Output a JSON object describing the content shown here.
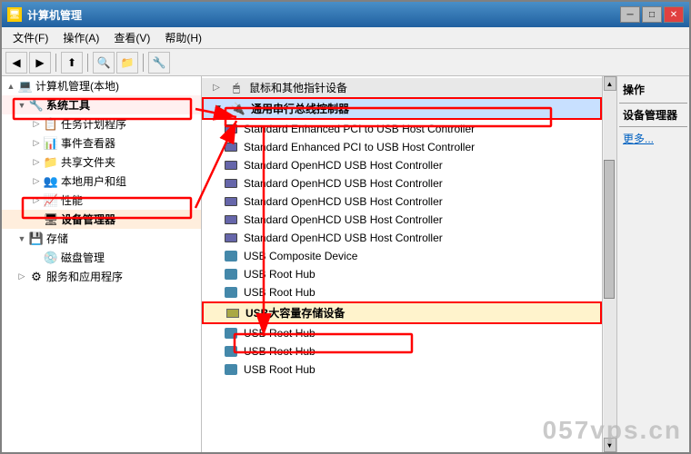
{
  "window": {
    "title": "计算机管理",
    "title_icon": "🖥",
    "btn_min": "─",
    "btn_max": "□",
    "btn_close": "✕"
  },
  "menubar": {
    "items": [
      {
        "label": "文件(F)"
      },
      {
        "label": "操作(A)"
      },
      {
        "label": "查看(V)"
      },
      {
        "label": "帮助(H)"
      }
    ]
  },
  "toolbar": {
    "buttons": [
      "◀",
      "▶",
      "⬆",
      "🔍",
      "📋",
      "🔧",
      "📄"
    ]
  },
  "left_panel": {
    "root": "计算机管理(本地)",
    "items": [
      {
        "label": "系统工具",
        "level": 1,
        "expanded": true,
        "selected": false,
        "highlight": true
      },
      {
        "label": "任务计划程序",
        "level": 2,
        "expanded": false,
        "selected": false
      },
      {
        "label": "事件查看器",
        "level": 2,
        "expanded": false,
        "selected": false
      },
      {
        "label": "共享文件夹",
        "level": 2,
        "expanded": false,
        "selected": false
      },
      {
        "label": "本地用户和组",
        "level": 2,
        "expanded": false,
        "selected": false
      },
      {
        "label": "性能",
        "level": 2,
        "expanded": false,
        "selected": false
      },
      {
        "label": "设备管理器",
        "level": 2,
        "expanded": false,
        "selected": false,
        "highlight": true
      },
      {
        "label": "存储",
        "level": 1,
        "expanded": true,
        "selected": false
      },
      {
        "label": "磁盘管理",
        "level": 2,
        "expanded": false,
        "selected": false
      },
      {
        "label": "服务和应用程序",
        "level": 1,
        "expanded": false,
        "selected": false
      }
    ]
  },
  "right_panel": {
    "header_items": [
      {
        "label": "鼠标和其他指针设备",
        "level": 0
      },
      {
        "label": "通用串行总线控制器",
        "level": 0,
        "highlight": true
      }
    ],
    "devices": [
      {
        "name": "Standard Enhanced PCI to USB Host Controller",
        "type": "pci"
      },
      {
        "name": "Standard Enhanced PCI to USB Host Controller",
        "type": "pci"
      },
      {
        "name": "Standard OpenHCD USB Host Controller",
        "type": "pci"
      },
      {
        "name": "Standard OpenHCD USB Host Controller",
        "type": "pci"
      },
      {
        "name": "Standard OpenHCD USB Host Controller",
        "type": "pci"
      },
      {
        "name": "Standard OpenHCD USB Host Controller",
        "type": "pci"
      },
      {
        "name": "Standard OpenHCD USB Host Controller",
        "type": "pci"
      },
      {
        "name": "USB Composite Device",
        "type": "usb"
      },
      {
        "name": "USB Root Hub",
        "type": "usb"
      },
      {
        "name": "USB Root Hub",
        "type": "usb"
      },
      {
        "name": "USB大容量存储设备",
        "type": "storage",
        "highlight": true
      },
      {
        "name": "USB Root Hub",
        "type": "usb"
      },
      {
        "name": "USB Root Hub",
        "type": "usb"
      },
      {
        "name": "USB Root Hub",
        "type": "usb"
      }
    ]
  },
  "actions_panel": {
    "title": "操作",
    "section_label": "设备管理器",
    "more_label": "更多..."
  },
  "watermark": "057vps.cn"
}
